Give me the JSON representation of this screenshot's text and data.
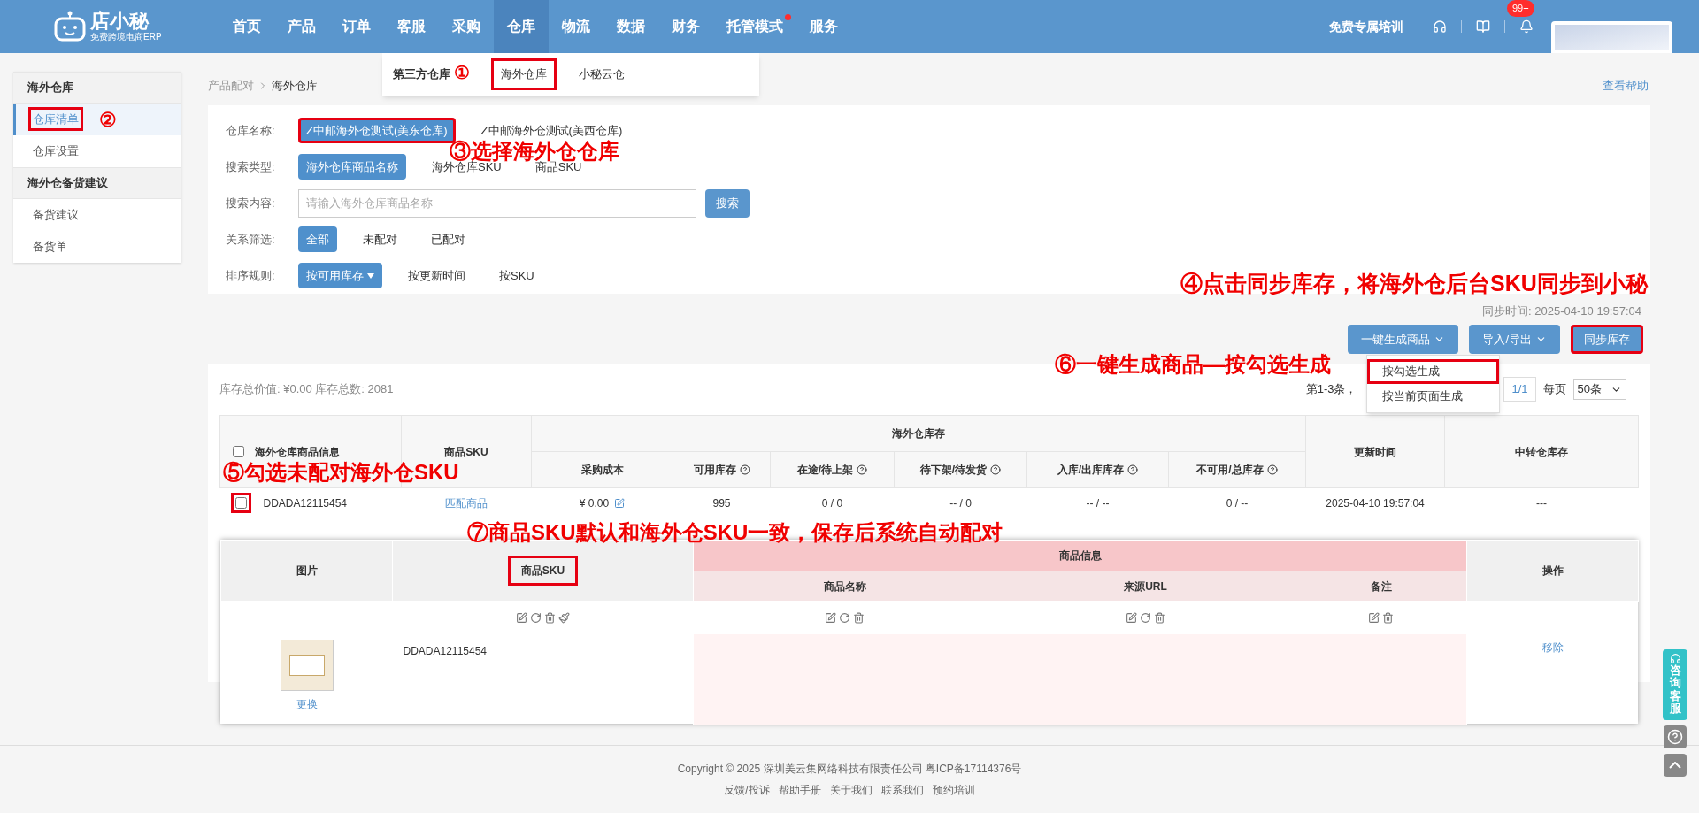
{
  "header": {
    "logo_text": "店小秘",
    "logo_subtitle": "免费跨境电商ERP",
    "nav": [
      {
        "label": "首页",
        "selected": false,
        "dot": false
      },
      {
        "label": "产品",
        "selected": false,
        "dot": false
      },
      {
        "label": "订单",
        "selected": false,
        "dot": false
      },
      {
        "label": "客服",
        "selected": false,
        "dot": false
      },
      {
        "label": "采购",
        "selected": false,
        "dot": false
      },
      {
        "label": "仓库",
        "selected": true,
        "dot": false
      },
      {
        "label": "物流",
        "selected": false,
        "dot": false
      },
      {
        "label": "数据",
        "selected": false,
        "dot": false
      },
      {
        "label": "财务",
        "selected": false,
        "dot": false
      },
      {
        "label": "托管模式",
        "selected": false,
        "dot": true
      },
      {
        "label": "服务",
        "selected": false,
        "dot": false
      }
    ],
    "training": "免费专属培训",
    "badge": "99+"
  },
  "nav_submenu": {
    "group": "第三方仓库",
    "items": [
      {
        "label": "海外仓库",
        "highlighted": true
      },
      {
        "label": "小秘云仓",
        "highlighted": false
      }
    ]
  },
  "sidebar": {
    "sections": [
      {
        "title": "海外仓库",
        "items": [
          {
            "label": "仓库清单",
            "selected": true,
            "highlighted": true
          },
          {
            "label": "仓库设置",
            "selected": false,
            "highlighted": false
          }
        ]
      },
      {
        "title": "海外仓备货建议",
        "items": [
          {
            "label": "备货建议",
            "selected": false,
            "highlighted": false
          },
          {
            "label": "备货单",
            "selected": false,
            "highlighted": false
          }
        ]
      }
    ]
  },
  "breadcrumb": [
    "产品配对",
    "海外仓库"
  ],
  "help_link": "查看帮助",
  "filters": [
    {
      "kind": "options",
      "label": "仓库名称:",
      "options": [
        {
          "label": "Z中邮海外仓测试(美东仓库)",
          "selected": true,
          "highlighted": true,
          "caret": false
        },
        {
          "label": "Z中邮海外仓测试(美西仓库)",
          "selected": false,
          "highlighted": false,
          "caret": false
        }
      ]
    },
    {
      "kind": "options",
      "label": "搜索类型:",
      "options": [
        {
          "label": "海外仓库商品名称",
          "selected": true,
          "highlighted": false,
          "caret": false
        },
        {
          "label": "海外仓库SKU",
          "selected": false,
          "highlighted": false,
          "caret": false
        },
        {
          "label": "商品SKU",
          "selected": false,
          "highlighted": false,
          "caret": false
        }
      ]
    },
    {
      "kind": "search",
      "label": "搜索内容:",
      "placeholder": "请输入海外仓库商品名称",
      "button": "搜索"
    },
    {
      "kind": "options",
      "label": "关系筛选:",
      "options": [
        {
          "label": "全部",
          "selected": true,
          "highlighted": false,
          "caret": false
        },
        {
          "label": "未配对",
          "selected": false,
          "highlighted": false,
          "caret": false
        },
        {
          "label": "已配对",
          "selected": false,
          "highlighted": false,
          "caret": false
        }
      ]
    },
    {
      "kind": "options",
      "label": "排序规则:",
      "options": [
        {
          "label": "按可用库存",
          "selected": true,
          "highlighted": false,
          "caret": true
        },
        {
          "label": "按更新时间",
          "selected": false,
          "highlighted": false,
          "caret": false
        },
        {
          "label": "按SKU",
          "selected": false,
          "highlighted": false,
          "caret": false
        }
      ]
    }
  ],
  "sync_time": "同步时间: 2025-04-10 19:57:04",
  "actions": [
    {
      "label": "一键生成商品",
      "dropdown": true,
      "highlighted": false
    },
    {
      "label": "导入/导出",
      "dropdown": true,
      "highlighted": false
    },
    {
      "label": "同步库存",
      "dropdown": false,
      "highlighted": true
    }
  ],
  "generate_menu": [
    {
      "label": "按勾选生成",
      "highlighted": true
    },
    {
      "label": "按当前页面生成",
      "highlighted": false
    }
  ],
  "summary": "库存总价值: ¥0.00 库存总数: 2081",
  "pagination": {
    "range": "第1-3条，",
    "page": "1/1",
    "per_page_label": "每页",
    "per_page": "50条"
  },
  "table": {
    "select_all_checked": false,
    "info_header": "海外仓库商品信息",
    "sku_header": "商品SKU",
    "group_header": "海外仓库存",
    "sub_columns": [
      {
        "label": "采购成本",
        "help": false
      },
      {
        "label": "可用库存",
        "help": true
      },
      {
        "label": "在途/待上架",
        "help": true
      },
      {
        "label": "待下架/待发货",
        "help": true
      },
      {
        "label": "入库/出库库存",
        "help": true
      },
      {
        "label": "不可用/总库存",
        "help": true
      }
    ],
    "tail_columns": [
      "更新时间",
      "中转仓库存"
    ],
    "rows": [
      {
        "checked": false,
        "highlighted": true,
        "sku": "DDADA12115454",
        "match": "匹配商品",
        "cost": "¥ 0.00",
        "values": [
          "995",
          "0 / 0",
          "-- / 0",
          "-- / --",
          "0 / --"
        ],
        "updated": "2025-04-10 19:57:04",
        "transit": "---"
      }
    ]
  },
  "dialog": {
    "image_header": "图片",
    "sku_header": "商品SKU",
    "sku_highlighted": true,
    "group_header": "商品信息",
    "sub_columns": [
      "商品名称",
      "来源URL",
      "备注"
    ],
    "action_header": "操作",
    "rows": [
      {
        "replace": "更换",
        "sku": "DDADA12115454",
        "remove": "移除"
      }
    ]
  },
  "footer": {
    "copyright": "Copyright © 2025 深圳美云集网络科技有限责任公司  粤ICP备17114376号",
    "links": [
      "反馈/投诉",
      "帮助手册",
      "关于我们",
      "联系我们",
      "预约培训"
    ]
  },
  "side_tools": {
    "service": "咨询客服"
  },
  "annotations": [
    "①",
    "②",
    "③选择海外仓仓库",
    "④点击同步库存，将海外仓后台SKU同步到小秘",
    "⑤勾选未配对海外仓SKU",
    "⑥一键生成商品—按勾选生成",
    "⑦商品SKU默认和海外仓SKU一致，保存后系统自动配对"
  ]
}
